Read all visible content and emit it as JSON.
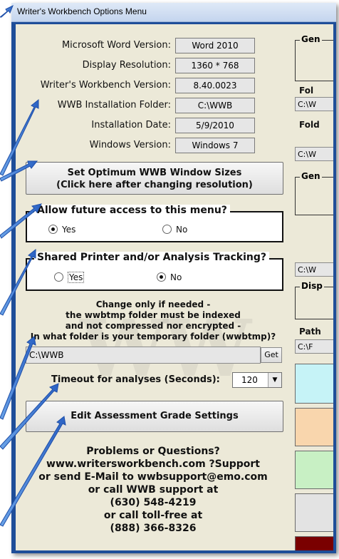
{
  "window": {
    "title": "Writer's Workbench Options Menu"
  },
  "info": [
    {
      "label": "Microsoft Word Version:",
      "value": "Word 2010"
    },
    {
      "label": "Display Resolution:",
      "value": "1360 * 768"
    },
    {
      "label": "Writer's Workbench Version:",
      "value": "8.40.0023"
    },
    {
      "label": "WWB Installation Folder:",
      "value": "C:\\WWB"
    },
    {
      "label": "Installation Date:",
      "value": "5/9/2010"
    },
    {
      "label": "Windows Version:",
      "value": "Windows 7"
    }
  ],
  "optimum_button": {
    "line1": "Set Optimum WWB Window Sizes",
    "line2": "(Click here after changing resolution)"
  },
  "future_access": {
    "title": "Allow future access to this menu?",
    "yes": "Yes",
    "no": "No",
    "selected": "Yes"
  },
  "shared_printer": {
    "title": "Shared Printer and/or Analysis Tracking?",
    "yes": "Yes",
    "no": "No",
    "selected": "No"
  },
  "temp_note": {
    "line1": "Change only if needed -",
    "line2": "the wwbtmp folder must be indexed",
    "line3": "and not compressed nor encrypted -",
    "line4": "In what folder is your temporary folder (wwbtmp)?"
  },
  "temp_folder": {
    "value": "C:\\WWB",
    "get_label": "Get"
  },
  "timeout": {
    "label": "Timeout for analyses (Seconds):",
    "value": "120"
  },
  "grade_button": {
    "label": "Edit Assessment Grade Settings"
  },
  "help": {
    "line1": "Problems or Questions?",
    "line2": "www.writersworkbench.com  ?Support",
    "line3": "or send E-Mail to wwbsupport@emo.com",
    "line4": "or call WWB support at",
    "line5": "(630) 548-4219",
    "line6": "or call toll-free at",
    "line7": "(888) 366-8326"
  },
  "right_column": {
    "gen1": "Gen",
    "fol1": "Fol",
    "field1": "C:\\W",
    "fol2": "Fold",
    "field2": "C:\\W",
    "gen2": "Gen",
    "field3": "C:\\W",
    "disp": "Disp",
    "path": "Path",
    "field4": "C:\\F"
  },
  "colors": {
    "frame_blue": "#1f4e99",
    "swatch_cyan": "#c6f3f7",
    "swatch_peach": "#f9d6ad",
    "swatch_green": "#c8f0c4",
    "swatch_gray": "#e3e3e3",
    "swatch_maroon": "#7a0000"
  }
}
